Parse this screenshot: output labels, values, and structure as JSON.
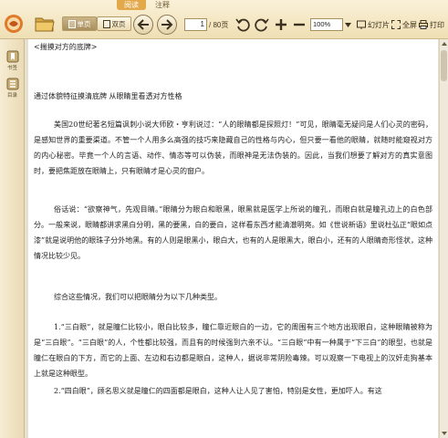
{
  "toolbar": {
    "tabs": [
      "阅读",
      "注释"
    ],
    "active_tab": "阅读",
    "view_single": "单页",
    "view_double": "双页",
    "page_current": "1",
    "page_total": "/ 80页",
    "zoom": "100%",
    "slideshow": "幻灯片",
    "fullscreen": "全屏",
    "print": "打印"
  },
  "sidebar": {
    "bookmark": "书签",
    "toc": "目录"
  },
  "document": {
    "heading": "<揣摸对方的底牌>",
    "subtitle": "通过体貌特征摸清底牌 从眼睛里看透对方性格",
    "paragraphs": [
      "美国20世纪著名短篇讽刺小说大师欧・亨利说过：“人的眼睛都是探照灯！”可见，眼睛毫无疑问是人们心灵的密码，是感知世界的重要渠道。不管一个人用多么高强的技巧来隐藏自己的性格与内心，但只要一看他的眼睛，就随时能窥视对方的内心秘密。毕竟一个人的言语、动作、情态等可以伪装，而眼神是无法伪装的。因此，当我们想要了解对方的真实意图时，要把焦距放在眼睛上，只有眼睛才是心灵的窗户。",
      "俗话说：“欲察神气，先观目睛。”眼睛分为眼白和眼黑，眼黑就是医学上所说的瞳孔，而眼白就是瞳孔边上的白色部分。一般来说，眼睛都讲求黑白分明，黑的要黑，白的要白，这样看东西才能清澈明亮。如《世说新语》里说杜弘正“眼如点漆”就是说明他的眼珠子分外地黑。有的人则是眼黑小，眼白大，也有的人是眼黑大，眼白小，还有的人眼睛奇形怪状，这种情况比较少见。",
      "综合这些情况，我们可以把眼睛分为以下几种类型。",
      "1.“三白眼”，就是瞳仁比较小，眼白比较多，瞳仁靠近眼白的一边，它的周围有三个地方出现眼白，这种眼睛被称为是“三白眼”。“三白眼”的人，个性都比较强，而且有的时候强到六亲不认。“三白眼”中有一种属于“下三白”的眼型，也就是瞳仁在眼白的下方，而它的上面、左边和右边都是眼白，这种人，据说非常阴险毒辣。可以观察一下电视上的汉奸走狗基本上就是这种眼型。",
      "2.“四白眼”，顾名思义就是瞳仁的四面都是眼白，这种人让人见了害怕，特别是女性，更加吓人。有这"
    ]
  },
  "colors": {
    "toolbar_bg": "#f3e6c4",
    "active_tab": "#e3a84a",
    "page_bg": "#ffffff",
    "frame_bg": "#e6e0d0"
  },
  "icons": [
    "app-logo-icon",
    "open-folder-icon",
    "prev-page-icon",
    "next-page-icon",
    "rotate-left-icon",
    "rotate-right-icon",
    "zoom-in-icon",
    "zoom-out-icon",
    "dropdown-arrow-icon",
    "slideshow-icon",
    "fullscreen-icon",
    "print-icon",
    "bookmark-icon",
    "toc-icon"
  ]
}
